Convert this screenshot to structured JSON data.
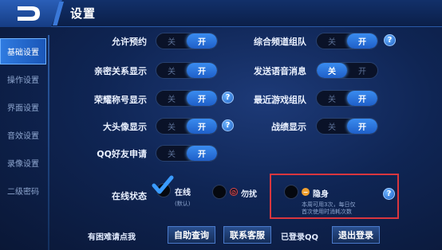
{
  "header": {
    "title": "设置"
  },
  "sidebar": {
    "items": [
      {
        "label": "基础设置",
        "active": true
      },
      {
        "label": "操作设置",
        "active": false
      },
      {
        "label": "界面设置",
        "active": false
      },
      {
        "label": "音效设置",
        "active": false
      },
      {
        "label": "录像设置",
        "active": false
      },
      {
        "label": "二级密码",
        "active": false
      }
    ]
  },
  "toggles": {
    "off_label": "关",
    "on_label": "开",
    "allow_reservation": {
      "label": "允许预约",
      "state": "on"
    },
    "intimacy_display": {
      "label": "亲密关系显示",
      "state": "on"
    },
    "honor_title_display": {
      "label": "荣耀称号显示",
      "state": "on"
    },
    "avatar_display": {
      "label": "大头像显示",
      "state": "on"
    },
    "qq_friend_request": {
      "label": "QQ好友申请",
      "state": "on"
    },
    "general_channel_team": {
      "label": "综合频道组队",
      "state": "on"
    },
    "send_voice_message": {
      "label": "发送语音消息",
      "state": "off"
    },
    "recent_game_team": {
      "label": "最近游戏组队",
      "state": "on"
    },
    "combat_display": {
      "label": "战绩显示",
      "state": "on"
    }
  },
  "online_status": {
    "label": "在线状态",
    "online": {
      "label": "在线",
      "sub": "(默认)",
      "selected": true
    },
    "do_not_disturb": {
      "label": "勿扰",
      "selected": false
    },
    "invisible": {
      "label": "隐身",
      "note_line1": "本周可用3次，每日仅",
      "note_line2": "首次使用时消耗次数",
      "selected": false
    }
  },
  "help_symbol": "?",
  "bottom": {
    "trouble_text": "有困难请点我",
    "self_service": "自助查询",
    "contact_support": "联系客服",
    "logged_in": "已登录QQ",
    "logout": "退出登录"
  },
  "colors": {
    "accent": "#2f7be0",
    "highlight_box": "#d9363e",
    "check": "#3a9bff"
  }
}
